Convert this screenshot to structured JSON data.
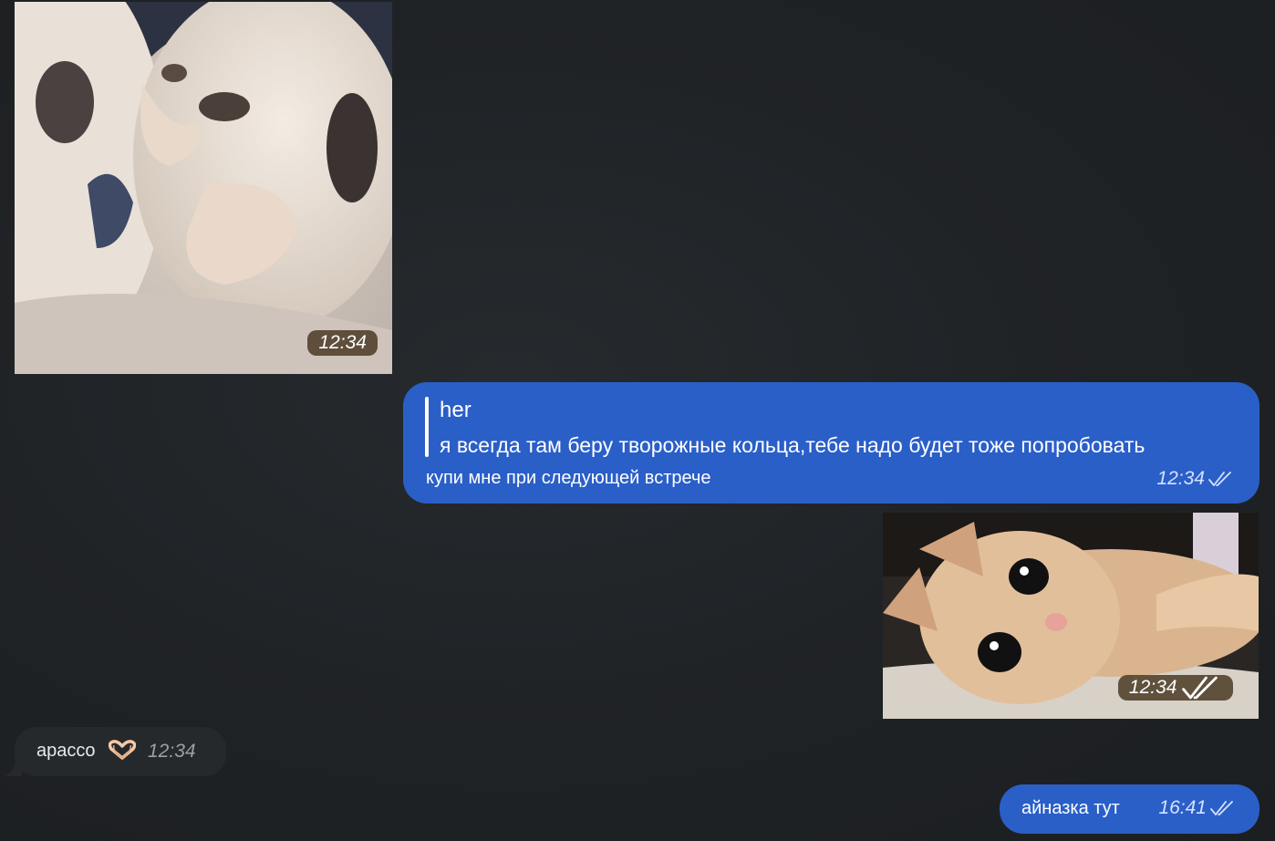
{
  "messages": {
    "kittens_photo": {
      "time": "12:34"
    },
    "reply_message": {
      "quoted_author": "her",
      "quoted_text": "я всегда там беру творожные кольца,тебе надо будет тоже попробовать",
      "text": "купи мне при следующей встрече",
      "time": "12:34",
      "status_icon": "double-check-icon"
    },
    "cat_photo": {
      "time": "12:34",
      "status_icon": "double-check-icon"
    },
    "incoming_text": {
      "text": "apacco",
      "emoji_icon": "heart-hands-icon",
      "time": "12:34"
    },
    "outgoing_last": {
      "text": "айназка тут",
      "time": "16:41",
      "status_icon": "double-check-icon"
    }
  },
  "colors": {
    "background": "#1e2124",
    "outgoing_bubble": "#2a5fc8",
    "incoming_bubble": "#26292c",
    "time_pill": "#46341e"
  }
}
